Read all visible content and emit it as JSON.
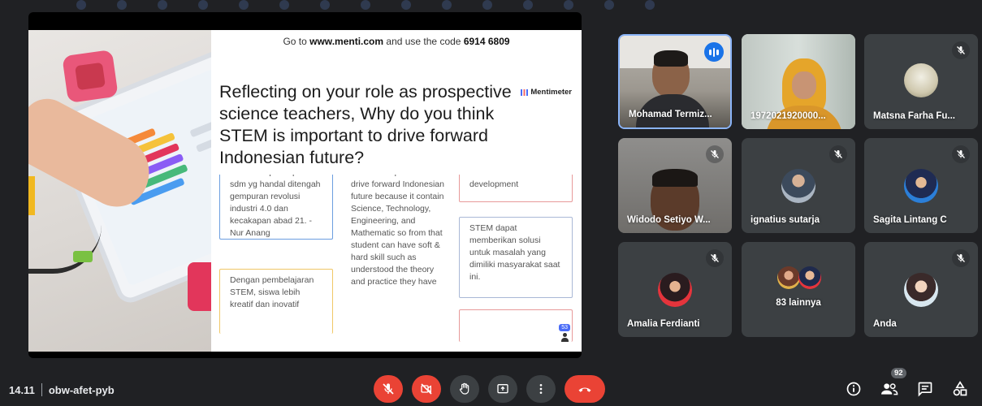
{
  "slide": {
    "code_prefix": "Go to",
    "code_site": "www.menti.com",
    "code_mid": "and use the code",
    "code_value": "6914 6809",
    "brand": "Mentimeter",
    "question": "Reflecting on your role as prospective science teachers, Why do you think STEM is important to drive forward Indonesian future?",
    "cards": [
      "Para mempersiapkan sdm yg handal ditengah gempuran revolusi industri 4.0 dan kecakapan abad 21. - Nur Anang",
      "Dengan pembelajaran STEM, siswa lebih kreatif dan inovatif",
      "STEM is important to drive forward Indonesian future because it contain Science, Technology, Engineering, and Mathematic so from that student can have soft & hard skill such as understood the theory and practice they have",
      "because of the current development",
      "STEM dapat memberikan solusi untuk masalah yang dimiliki masyarakat saat ini.",
      ""
    ],
    "response_count": "53"
  },
  "participants": [
    {
      "name": "Mohamad Termiz...",
      "speaking": true
    },
    {
      "name": "1972021920000...",
      "muted": false
    },
    {
      "name": "Matsna Farha Fu...",
      "muted": true
    },
    {
      "name": "Widodo Setiyo W...",
      "muted": true
    },
    {
      "name": "ignatius sutarja",
      "muted": true
    },
    {
      "name": "Sagita Lintang C",
      "muted": true
    },
    {
      "name": "Amalia Ferdianti",
      "muted": true
    },
    {
      "name": "83 lainnya"
    },
    {
      "name": "Anda",
      "muted": true
    }
  ],
  "meeting": {
    "time": "14.11",
    "code": "obw-afet-pyb",
    "participant_count": "92"
  },
  "controls": {
    "mic": "mic-off-icon",
    "camera": "camera-off-icon",
    "hand": "raise-hand-icon",
    "present": "present-screen-icon",
    "more": "more-vert-icon",
    "leave": "call-end-icon",
    "info": "info-icon",
    "people": "people-icon",
    "chat": "chat-icon",
    "activities": "activities-icon"
  },
  "colors": {
    "background": "#202124",
    "tile": "#3c4043",
    "red": "#ea4335",
    "accent_blue": "#1a73e8",
    "active_border": "#8ab4f8"
  }
}
